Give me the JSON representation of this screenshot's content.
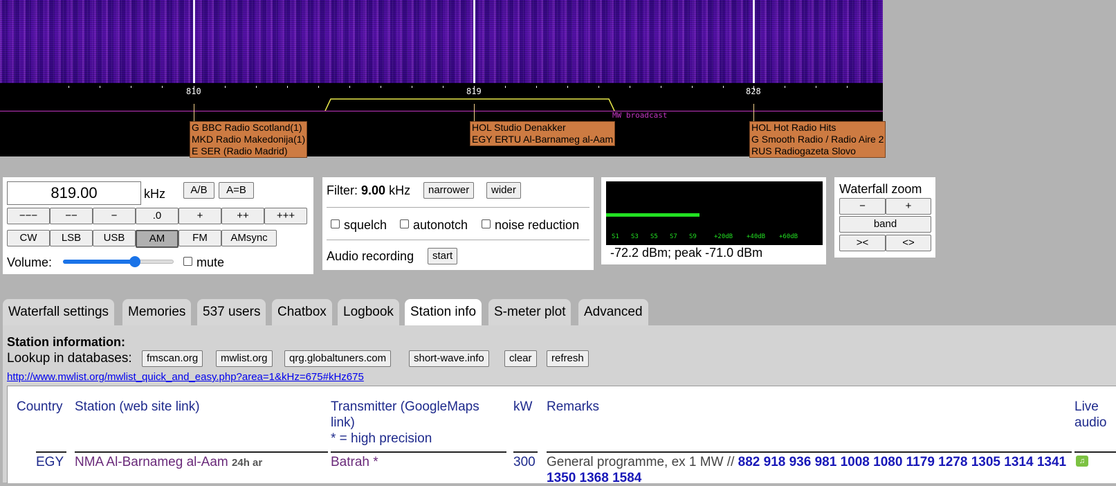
{
  "spectrum": {
    "freq_labels": [
      "810",
      "819",
      "828"
    ],
    "band_label": "MW broadcast",
    "stations": [
      [
        "G BBC Radio Scotland(1)",
        "MKD Radio Makedonija(1)",
        "E SER (Radio Madrid)"
      ],
      [
        "HOL Studio Denakker",
        "EGY ERTU Al-Barnameg al-Aam"
      ],
      [
        "HOL Hot Radio Hits",
        "G Smooth Radio / Radio Aire 2",
        "RUS Radiogazeta Slovo"
      ]
    ]
  },
  "tuning": {
    "frequency": "819.00",
    "unit": "kHz",
    "ab": "A/B",
    "a_eq_b": "A=B",
    "steps": [
      "−−−",
      "−−",
      "−",
      ".0",
      "+",
      "++",
      "+++"
    ],
    "modes": [
      "CW",
      "LSB",
      "USB",
      "AM",
      "FM",
      "AMsync"
    ],
    "active_mode": "AM",
    "volume_label": "Volume:",
    "volume_level": 0.67,
    "mute": "mute"
  },
  "filter": {
    "label": "Filter:",
    "value": "9.00",
    "unit": "kHz",
    "narrower": "narrower",
    "wider": "wider",
    "squelch": "squelch",
    "autonotch": "autonotch",
    "noise_reduction": "noise reduction",
    "audio_recording": "Audio recording",
    "start": "start"
  },
  "smeter": {
    "scale": [
      "S1",
      "S3",
      "S5",
      "S7",
      "S9",
      "+20dB",
      "+40dB",
      "+60dB"
    ],
    "reading": "-72.2 dBm; peak  -71.0 dBm",
    "level_fraction": 0.43,
    "bar_color": "#22e022"
  },
  "zoom": {
    "title": "Waterfall zoom",
    "minus": "−",
    "plus": "+",
    "band": "band",
    "narrow": "><",
    "wide": "<>"
  },
  "tabs": [
    "Waterfall settings",
    "Memories",
    "537 users",
    "Chatbox",
    "Logbook",
    "Station info",
    "S-meter plot",
    "Advanced"
  ],
  "selected_tab": "Station info",
  "station_info": {
    "heading": "Station information:",
    "lookup_label": "Lookup in databases:",
    "lookup_buttons": [
      "fmscan.org",
      "mwlist.org",
      "qrg.globaltuners.com",
      "short-wave.info",
      "clear",
      "refresh"
    ],
    "link": "http://www.mwlist.org/mwlist_quick_and_easy.php?area=1&kHz=675#kHz675",
    "columns": {
      "country": "Country",
      "station": "Station (web site link)",
      "transmitter_1": "Transmitter (GoogleMaps",
      "transmitter_2": "link)",
      "transmitter_3": "* = high precision",
      "kw": "kW",
      "remarks": "Remarks",
      "live_1": "Live",
      "live_2": "audio"
    },
    "row": {
      "country": "EGY",
      "station": "NMA Al-Barnameg al-Aam",
      "schedule": "24h ar",
      "transmitter": "Batrah *",
      "kw": "300",
      "remarks_prefix": "General programme, ex 1 MW //",
      "freqs_line1": "882 918 936 981 1008 1080 1179 1278 1305 1314",
      "freqs_line2": "1341 1350 1368 1584"
    }
  }
}
